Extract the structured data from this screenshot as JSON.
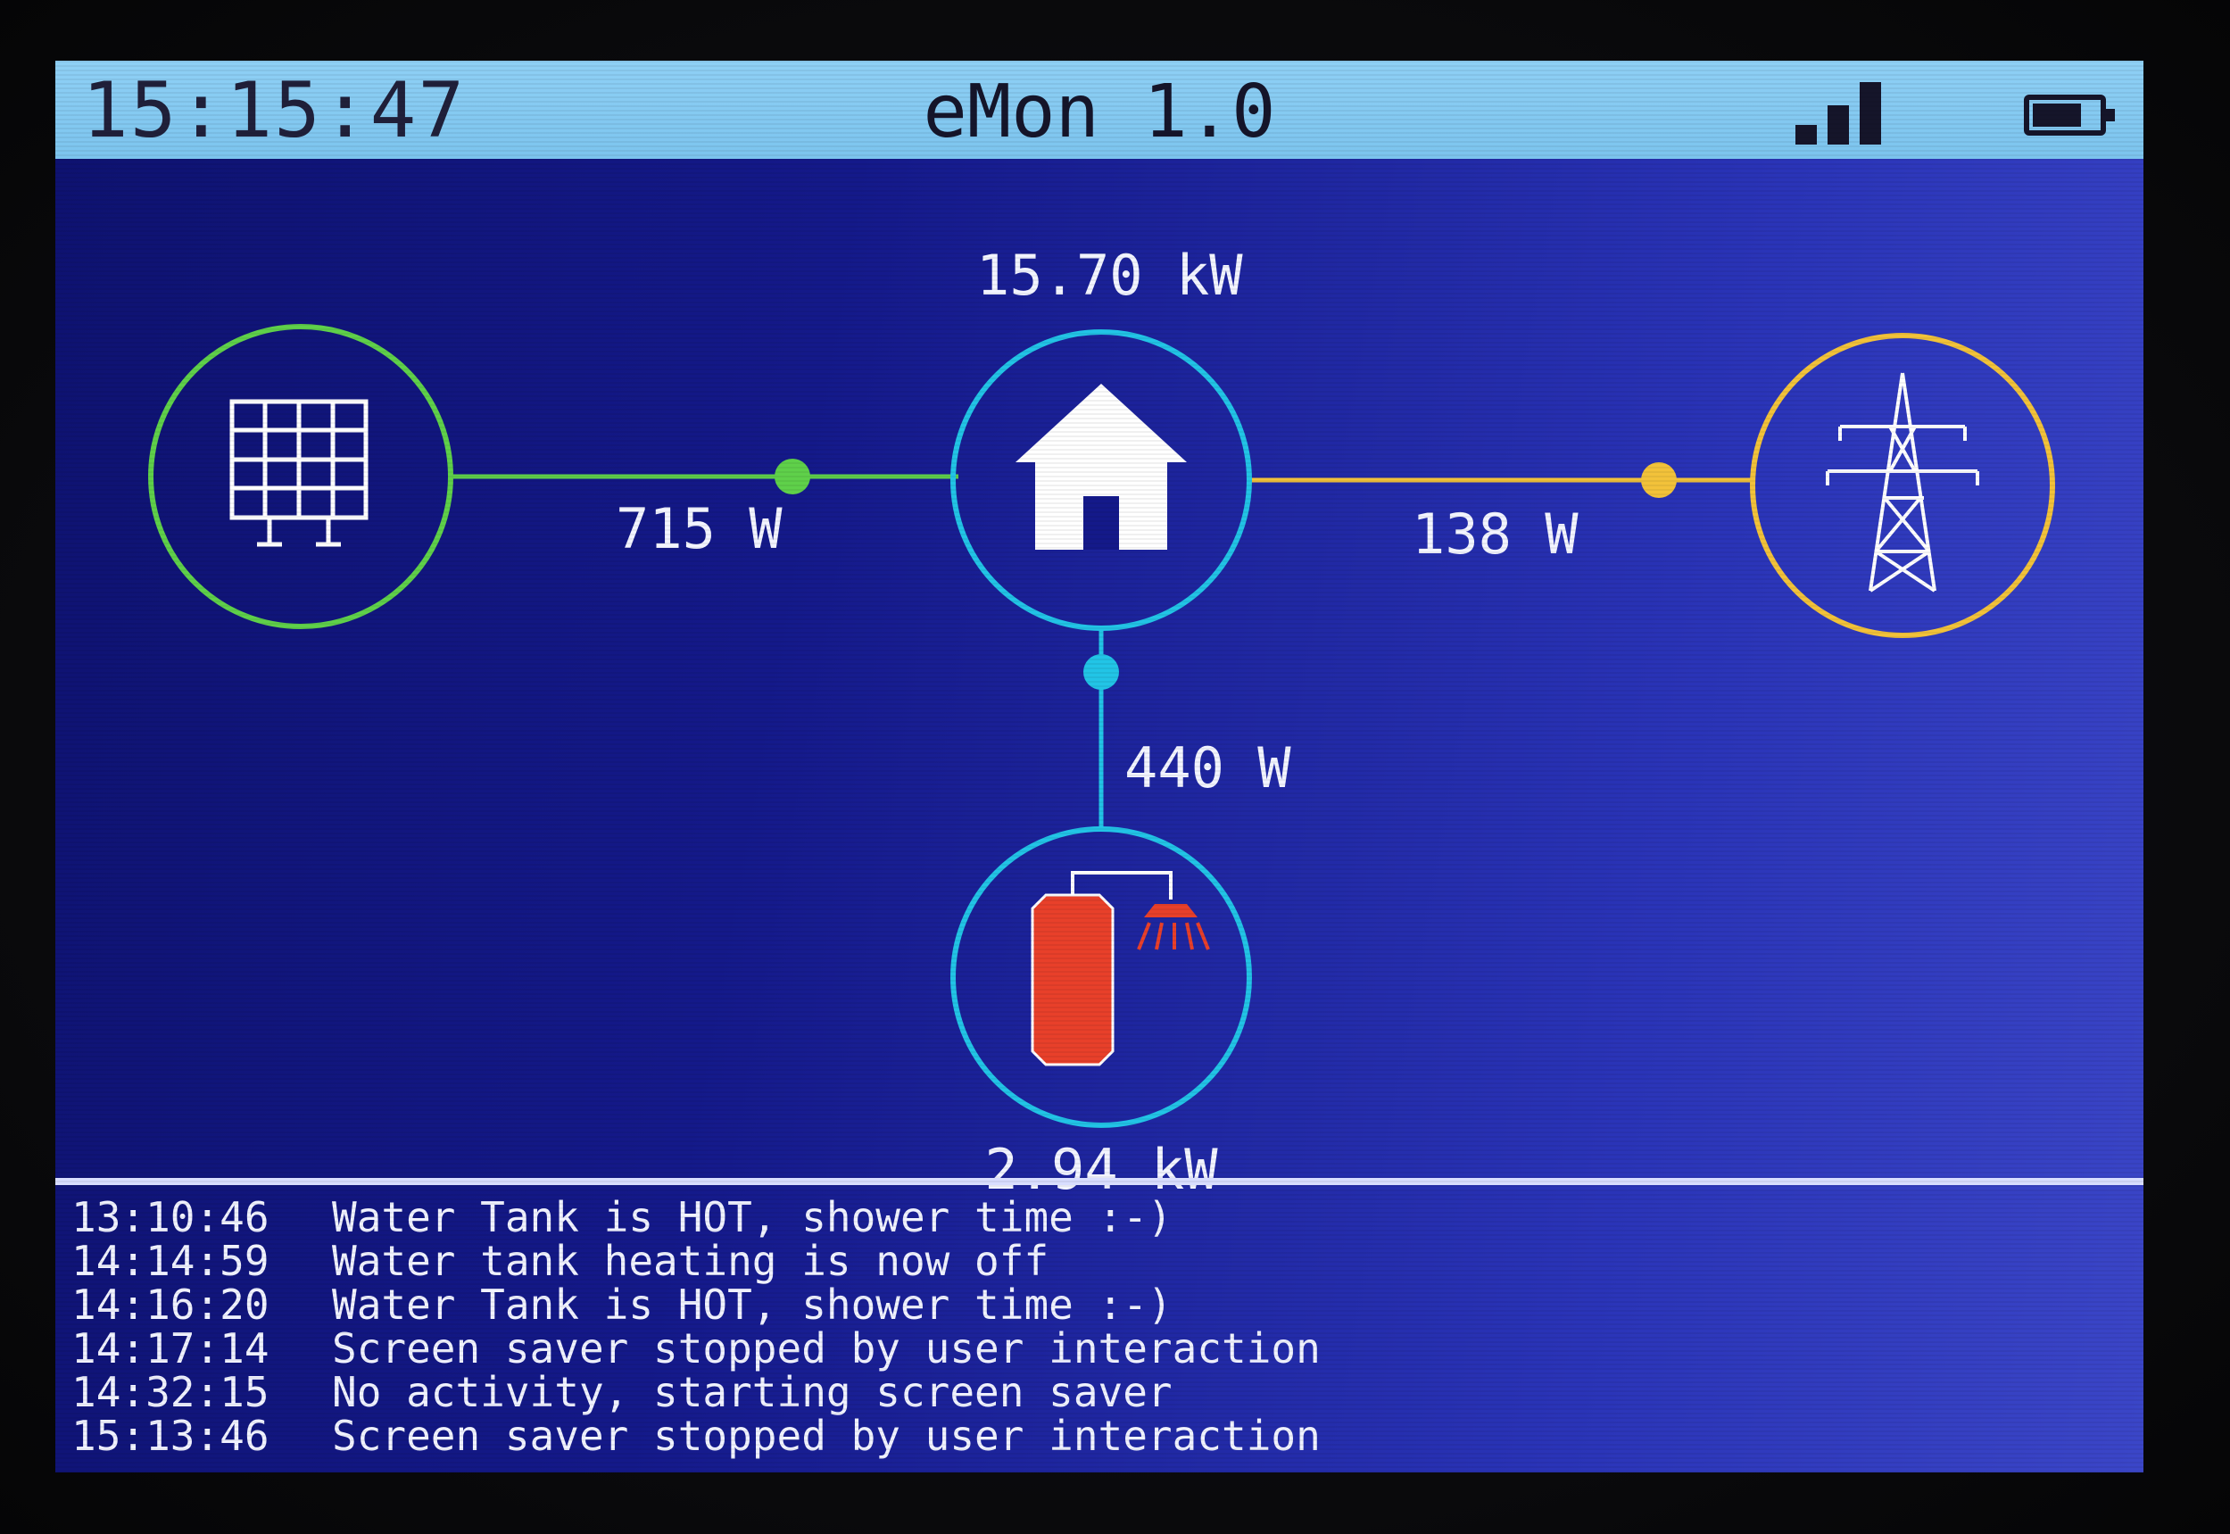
{
  "header": {
    "clock": "15:15:47",
    "title": "eMon 1.0",
    "signal_level": 3,
    "battery_level": 0.75
  },
  "nodes": {
    "solar": {
      "icon": "solar-panel-icon",
      "color": "#5fd04a"
    },
    "house": {
      "icon": "house-icon",
      "value": "15.70 kW",
      "color": "#22c4e6"
    },
    "grid": {
      "icon": "power-pylon-icon",
      "color": "#f2c23a"
    },
    "water_tank": {
      "icon": "water-tank-shower-icon",
      "value": "2.94 kW",
      "color": "#22c4e6"
    }
  },
  "flows": {
    "solar_to_house": "715 W",
    "grid_to_house": "138 W",
    "house_to_tank": "440 W"
  },
  "log": [
    {
      "time": "13:10:46",
      "message": "Water Tank is HOT, shower time :-)"
    },
    {
      "time": "14:14:59",
      "message": "Water tank heating is now off"
    },
    {
      "time": "14:16:20",
      "message": "Water Tank is HOT, shower time :-)"
    },
    {
      "time": "14:17:14",
      "message": "Screen saver stopped by user interaction"
    },
    {
      "time": "14:32:15",
      "message": "No activity, starting screen saver"
    },
    {
      "time": "15:13:46",
      "message": "Screen saver stopped by user interaction"
    }
  ]
}
